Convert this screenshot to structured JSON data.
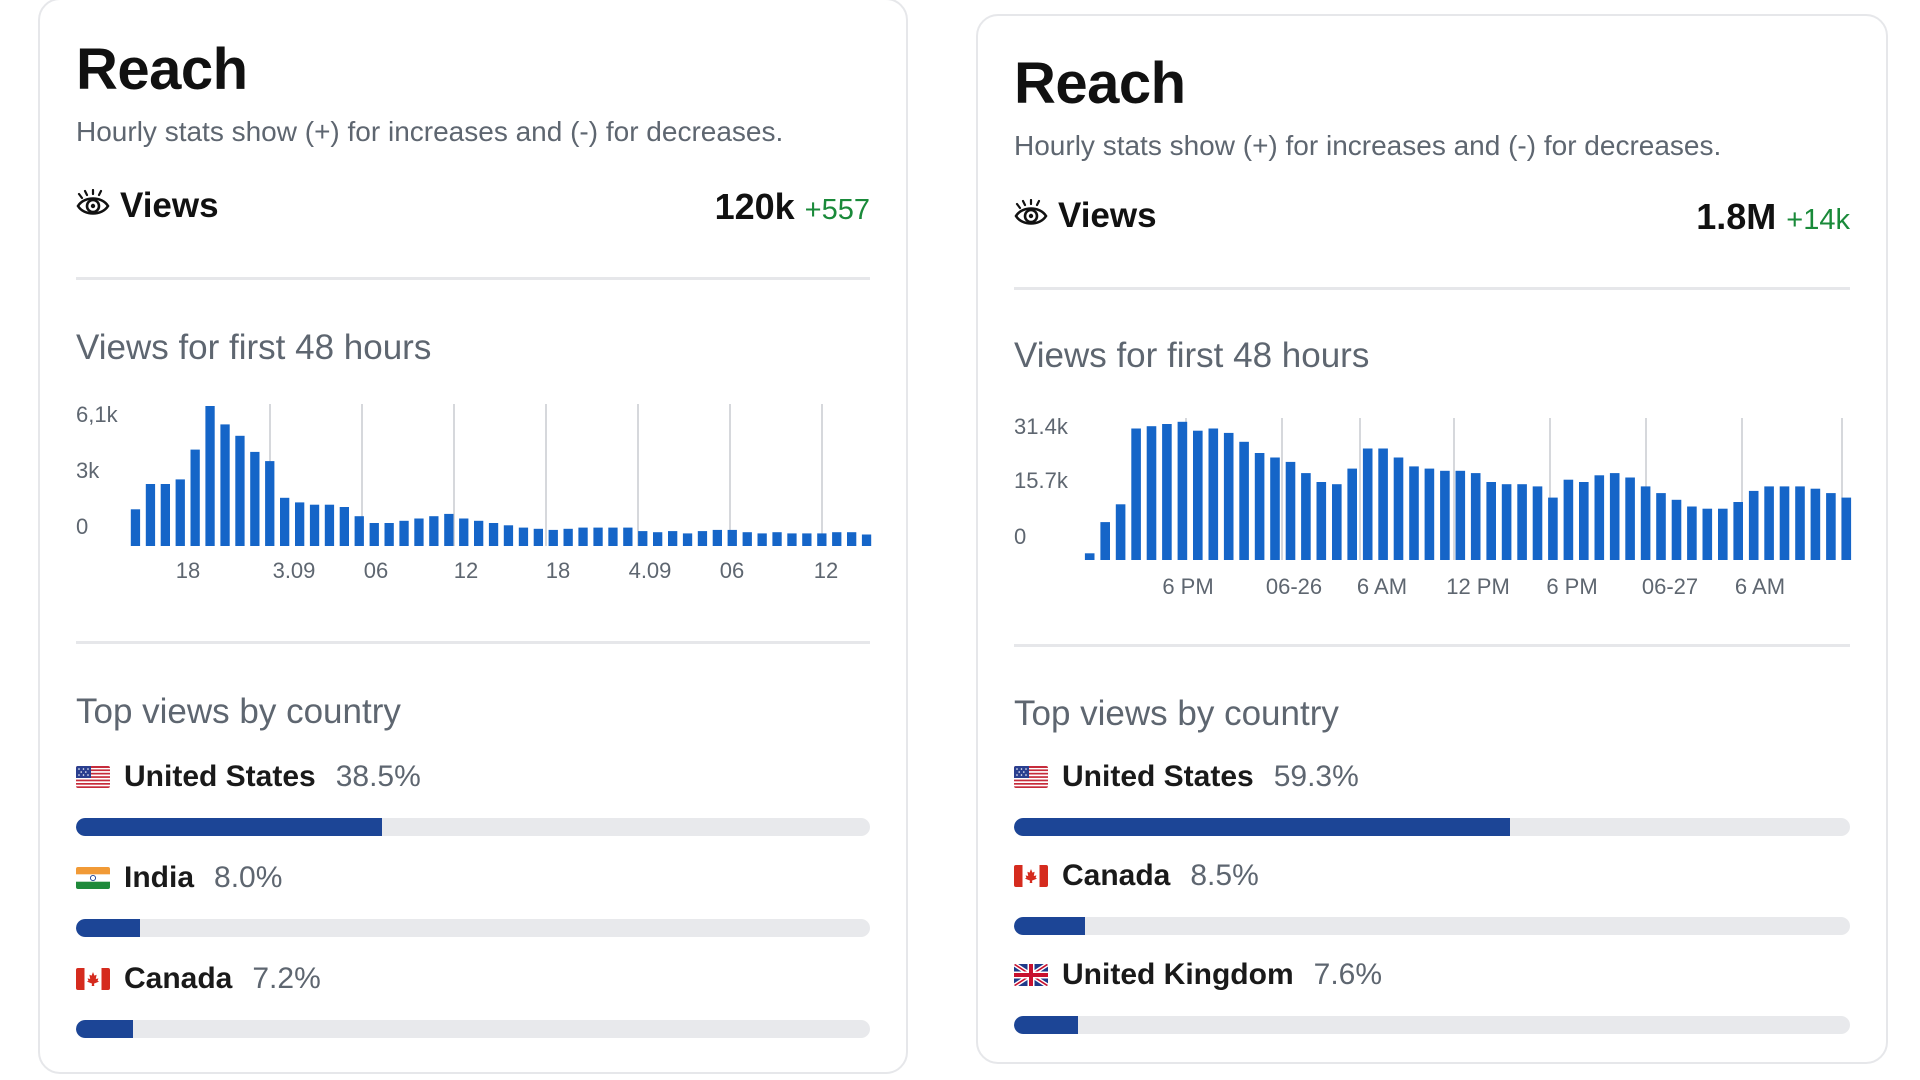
{
  "colors": {
    "bar": "#1565c8",
    "progress": "#1c4596",
    "track": "#e8e9ec",
    "delta": "#1a8a3a",
    "grid": "#c9ccd1"
  },
  "cards": [
    {
      "title": "Reach",
      "subtitle": "Hourly stats show (+) for increases and (-) for decreases.",
      "views": {
        "icon": "eye-icon",
        "label": "Views",
        "value": "120k",
        "delta": "+557"
      },
      "chart_title": "Views for first 48 hours",
      "chart_data": {
        "type": "bar",
        "ytick_labels": [
          "6,1k",
          "3k",
          "0"
        ],
        "yticks": [
          6100,
          3000,
          0
        ],
        "ylim": [
          0,
          6100
        ],
        "grid": "vertical",
        "xtick_labels": [
          "18",
          "3.09",
          "06",
          "12",
          "18",
          "4.09",
          "06",
          "12"
        ],
        "values": [
          1600,
          2700,
          2700,
          2900,
          4200,
          6100,
          5300,
          4800,
          4100,
          3700,
          2100,
          1900,
          1800,
          1800,
          1700,
          1300,
          1000,
          1000,
          1100,
          1200,
          1300,
          1400,
          1200,
          1100,
          1000,
          900,
          800,
          750,
          700,
          750,
          800,
          800,
          800,
          800,
          650,
          600,
          650,
          550,
          650,
          700,
          700,
          600,
          550,
          600,
          550,
          550,
          550,
          600,
          600,
          500
        ]
      },
      "countries_title": "Top views by country",
      "countries": [
        {
          "name": "United States",
          "pct_label": "38.5%",
          "pct": 38.5,
          "flag": "flag-us-icon"
        },
        {
          "name": "India",
          "pct_label": "8.0%",
          "pct": 8.0,
          "flag": "flag-in-icon"
        },
        {
          "name": "Canada",
          "pct_label": "7.2%",
          "pct": 7.2,
          "flag": "flag-ca-icon"
        }
      ]
    },
    {
      "title": "Reach",
      "subtitle": "Hourly stats show (+) for increases and (-) for decreases.",
      "views": {
        "icon": "eye-icon",
        "label": "Views",
        "value": "1.8M",
        "delta": "+14k"
      },
      "chart_title": "Views for first 48 hours",
      "chart_data": {
        "type": "bar",
        "ytick_labels": [
          "31.4k",
          "15.7k",
          "0"
        ],
        "yticks": [
          31400,
          15700,
          0
        ],
        "ylim": [
          0,
          31400
        ],
        "grid": "vertical",
        "xtick_labels": [
          "6 PM",
          "06-26",
          "6 AM",
          "12 PM",
          "6 PM",
          "06-27",
          "6 AM"
        ],
        "values": [
          1500,
          8500,
          12500,
          29500,
          30000,
          30500,
          31000,
          29000,
          29500,
          28500,
          26500,
          24000,
          23000,
          22000,
          19500,
          17500,
          17000,
          20500,
          25000,
          25000,
          23000,
          21000,
          20500,
          20000,
          20000,
          19500,
          17500,
          17000,
          17000,
          16500,
          14000,
          18000,
          17500,
          19000,
          19500,
          18500,
          16500,
          15000,
          13500,
          12000,
          11500,
          11500,
          13000,
          15500,
          16500,
          16500,
          16500,
          16000,
          15000,
          14000
        ]
      },
      "countries_title": "Top views by country",
      "countries": [
        {
          "name": "United States",
          "pct_label": "59.3%",
          "pct": 59.3,
          "flag": "flag-us-icon"
        },
        {
          "name": "Canada",
          "pct_label": "8.5%",
          "pct": 8.5,
          "flag": "flag-ca-icon"
        },
        {
          "name": "United Kingdom",
          "pct_label": "7.6%",
          "pct": 7.6,
          "flag": "flag-uk-icon"
        }
      ]
    }
  ]
}
